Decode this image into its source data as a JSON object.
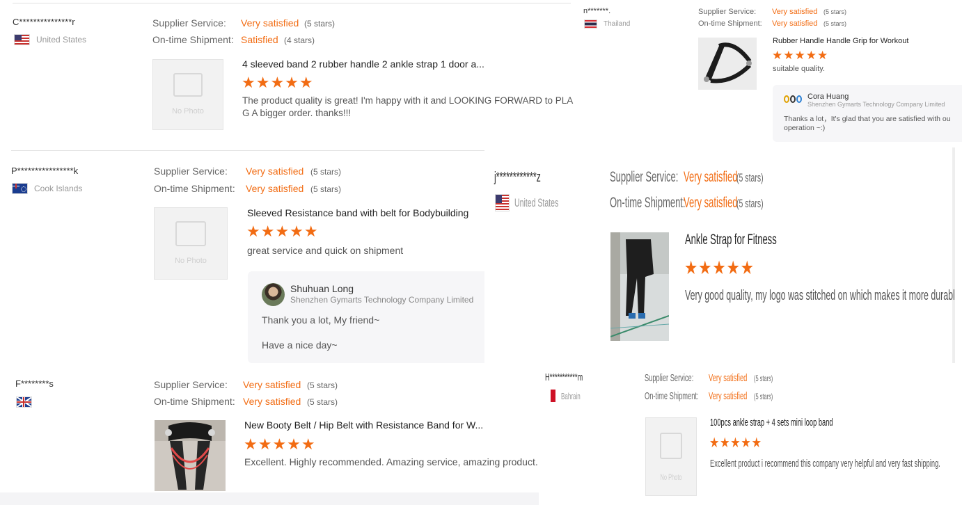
{
  "colors": {
    "accent": "#f26c13",
    "muted": "#999999",
    "text": "#333333"
  },
  "labels": {
    "supplier_service": "Supplier Service:",
    "on_time_shipment": "On-time Shipment:",
    "no_photo": "No Photo"
  },
  "reviews": [
    {
      "buyer": "C***************r",
      "country": "United States",
      "flag": "us-flag",
      "supplier_value": "Very satisfied",
      "supplier_stars": "(5 stars)",
      "shipment_value": "Satisfied",
      "shipment_stars": "(4 stars)",
      "product_title": "4 sleeved band 2 rubber handle 2 ankle strap 1 door a...",
      "product_image": "no-photo",
      "rating": 5,
      "comment": "The product quality is great! I'm happy with it and LOOKING FORWARD to PLA G A bigger order. thanks!!!"
    },
    {
      "buyer": "n*******.",
      "country": "Thailand",
      "flag": "th-flag",
      "supplier_value": "Very satisfied",
      "supplier_stars": "(5 stars)",
      "shipment_value": "Very satisfied",
      "shipment_stars": "(5 stars)",
      "product_title": "Rubber Handle Handle Grip for Workout",
      "product_image": "handle-grip-photo",
      "rating": 5,
      "comment": "suitable quality.",
      "reply": {
        "name": "Cora Huang",
        "company": "Shenzhen Gymarts Technology Company Limited",
        "text": "Thanks a lot，It's glad that you are satisfied with ou operation ~:)"
      }
    },
    {
      "buyer": "P****************k",
      "country": "Cook Islands",
      "flag": "ck-flag",
      "supplier_value": "Very satisfied",
      "supplier_stars": "(5 stars)",
      "shipment_value": "Very satisfied",
      "shipment_stars": "(5 stars)",
      "product_title": "Sleeved Resistance band with belt for Bodybuilding",
      "product_image": "no-photo",
      "rating": 5,
      "comment": "great service and quick on shipment",
      "reply": {
        "name": "Shuhuan Long",
        "company": "Shenzhen Gymarts Technology Company Limited",
        "text_line1": "Thank you a lot, My friend~",
        "text_line2": "Have a nice day~"
      }
    },
    {
      "buyer": "j************z",
      "country": "United States",
      "flag": "us-flag",
      "supplier_value": "Very satisfied",
      "supplier_stars": "(5 stars)",
      "shipment_value": "Very satisfied",
      "shipment_stars": "(5 stars)",
      "product_title": "Ankle Strap for Fitness",
      "product_image": "ankle-strap-photo",
      "rating": 5,
      "comment": "Very good quality,  my logo was stitched on which makes it more durable."
    },
    {
      "buyer": "F********s",
      "country": "",
      "flag": "uk-flag",
      "supplier_value": "Very satisfied",
      "supplier_stars": "(5 stars)",
      "shipment_value": "Very satisfied",
      "shipment_stars": "(5 stars)",
      "product_title": "New Booty Belt / Hip Belt with Resistance Band for W...",
      "product_image": "booty-belt-photo",
      "rating": 5,
      "comment": "Excellent. Highly recommended. Amazing service, amazing product."
    },
    {
      "buyer": "H***********m",
      "country": "Bahrain",
      "flag": "bh-flag",
      "supplier_value": "Very satisfied",
      "supplier_stars": "(5 stars)",
      "shipment_value": "Very satisfied",
      "shipment_stars": "(5 stars)",
      "product_title": "100pcs ankle strap + 4 sets mini loop band",
      "product_image": "no-photo",
      "rating": 5,
      "comment": "Excellent product i recommend this company very helpful and very fast shipping."
    }
  ]
}
